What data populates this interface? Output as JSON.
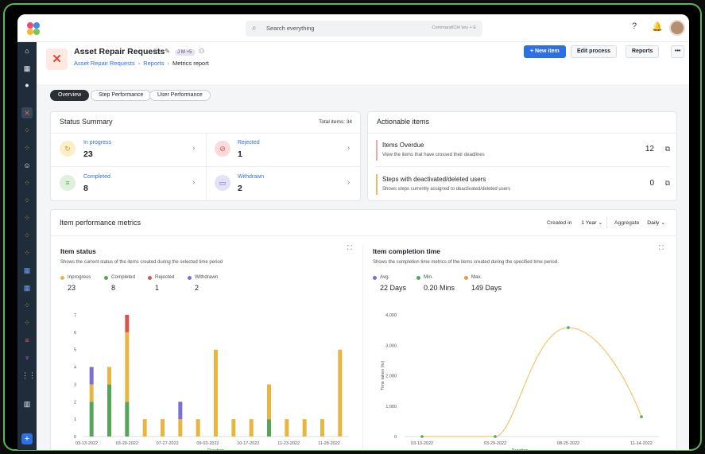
{
  "search": {
    "placeholder": "Search everything",
    "shortcut": "Command/Ctrl key + E"
  },
  "header": {
    "title": "Asset Repair Requests",
    "avatar_initials": "J",
    "avatar_initials2": "M",
    "avatar_more": "+5",
    "breadcrumb": [
      "Asset Repair Requests",
      "Reports",
      "Metrics report"
    ],
    "new_item": "+ New item",
    "edit_process": "Edit process",
    "reports": "Reports",
    "more": "•••"
  },
  "tabs": [
    {
      "label": "Overview"
    },
    {
      "label": "Step Performance"
    },
    {
      "label": "User Performance"
    }
  ],
  "status_summary": {
    "title": "Status Summary",
    "total": "Total items: 34",
    "tiles": [
      {
        "label": "In progress",
        "value": "23"
      },
      {
        "label": "Rejected",
        "value": "1"
      },
      {
        "label": "Completed",
        "value": "8"
      },
      {
        "label": "Withdrawn",
        "value": "2"
      }
    ]
  },
  "actionable": {
    "title": "Actionable items",
    "items": [
      {
        "title": "Items Overdue",
        "subtitle": "View the items that have crossed their deadlines",
        "count": "12",
        "color": "#f2a8a0"
      },
      {
        "title": "Steps with deactivated/deleted users",
        "subtitle": "Shows steps currently assigned to deactivated/deleted users",
        "count": "0",
        "color": "#f0b865"
      }
    ]
  },
  "metrics": {
    "title": "Item performance metrics",
    "created_label": "Created in",
    "created_value": "1 Year",
    "aggregate_label": "Aggregate",
    "aggregate_value": "Daily"
  },
  "item_status": {
    "title": "Item status",
    "subtitle": "Shows the current status of the items created during the selected time period",
    "legend": [
      {
        "name": "Inprogress",
        "value": "23",
        "color": "#e8b53e"
      },
      {
        "name": "Completed",
        "value": "8",
        "color": "#57a55a"
      },
      {
        "name": "Rejected",
        "value": "1",
        "color": "#d9534f"
      },
      {
        "name": "Withdrawn",
        "value": "2",
        "color": "#7b6fd6"
      }
    ]
  },
  "completion": {
    "title": "Item completion time",
    "subtitle": "Shows the completion time metrics of the items created during the specified time period.",
    "legend": [
      {
        "name": "Avg.",
        "value": "22 Days",
        "color": "#7b6fd6"
      },
      {
        "name": "Min.",
        "value": "0.20 Mins",
        "color": "#57a55a"
      },
      {
        "name": "Max.",
        "value": "149 Days",
        "color": "#e89a3e"
      }
    ]
  },
  "chart_data": [
    {
      "type": "bar",
      "stacked": true,
      "xlabel": "Duration",
      "ylabel": "",
      "ylim": [
        0,
        7
      ],
      "yticks": [
        0,
        1,
        2,
        3,
        4,
        5,
        6,
        7
      ],
      "tick_labels": [
        "03-13-2022",
        "03-29-2022",
        "07-27-2022",
        "09-03-2022",
        "10-17-2022",
        "11-23-2022",
        "11-28-2022"
      ],
      "x": [
        "b1",
        "b2",
        "b3",
        "b4",
        "b5",
        "b6",
        "b7",
        "b8",
        "b9",
        "b10",
        "b11",
        "b12",
        "b13",
        "b14",
        "b15"
      ],
      "series": [
        {
          "name": "Completed",
          "color": "#57a55a",
          "values": [
            2,
            3,
            2,
            0,
            0,
            0,
            0,
            0,
            0,
            0,
            1,
            0,
            0,
            0,
            0
          ]
        },
        {
          "name": "Inprogress",
          "color": "#e8b53e",
          "values": [
            1,
            1,
            4,
            1,
            1,
            1,
            1,
            5,
            1,
            1,
            2,
            1,
            1,
            1,
            5
          ]
        },
        {
          "name": "Rejected",
          "color": "#d9534f",
          "values": [
            0,
            0,
            1,
            0,
            0,
            0,
            0,
            0,
            0,
            0,
            0,
            0,
            0,
            0,
            0
          ]
        },
        {
          "name": "Withdrawn",
          "color": "#7b6fd6",
          "values": [
            1,
            0,
            0,
            0,
            0,
            1,
            0,
            0,
            0,
            0,
            0,
            0,
            0,
            0,
            0
          ]
        }
      ]
    },
    {
      "type": "line",
      "xlabel": "Duration",
      "ylabel": "Time taken (hr)",
      "ylim": [
        0,
        4000
      ],
      "yticks": [
        "0",
        "1,000",
        "2,000",
        "3,000",
        "4,000"
      ],
      "tick_labels": [
        "03-13-2022",
        "03-29-2022",
        "08-25-2022",
        "11-14-2022"
      ],
      "x": [
        0,
        1,
        2,
        3
      ],
      "values": [
        0,
        0,
        3580,
        650
      ]
    }
  ]
}
